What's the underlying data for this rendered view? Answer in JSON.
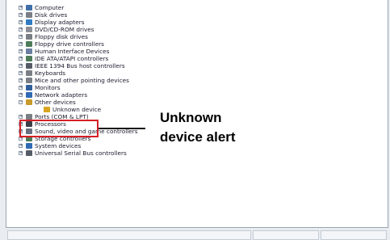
{
  "device_tree": {
    "items": [
      {
        "label": "Computer",
        "color": "#3f6ea8",
        "child": false
      },
      {
        "label": "Disk drives",
        "color": "#7a7f86",
        "child": false
      },
      {
        "label": "Display adapters",
        "color": "#2f7cc4",
        "child": false
      },
      {
        "label": "DVD/CD-ROM drives",
        "color": "#8c8f95",
        "child": false
      },
      {
        "label": "Floppy disk drives",
        "color": "#7a7f86",
        "child": false
      },
      {
        "label": "Floppy drive controllers",
        "color": "#4e7c5a",
        "child": false
      },
      {
        "label": "Human Interface Devices",
        "color": "#6a7fa0",
        "child": false
      },
      {
        "label": "IDE ATA/ATAPI controllers",
        "color": "#4e7c5a",
        "child": false
      },
      {
        "label": "IEEE 1394 Bus host controllers",
        "color": "#555c66",
        "child": false
      },
      {
        "label": "Keyboards",
        "color": "#7a7f86",
        "child": false
      },
      {
        "label": "Mice and other pointing devices",
        "color": "#7a7f86",
        "child": false
      },
      {
        "label": "Monitors",
        "color": "#2f5f9c",
        "child": false
      },
      {
        "label": "Network adapters",
        "color": "#2f6ab4",
        "child": false
      },
      {
        "label": "Other devices",
        "color": "#c89a2a",
        "child": false
      },
      {
        "label": "Unknown device",
        "color": "#d9a520",
        "child": true
      },
      {
        "label": "Ports (COM & LPT)",
        "color": "#7a7f86",
        "child": false
      },
      {
        "label": "Processors",
        "color": "#3a3f47",
        "child": false
      },
      {
        "label": "Sound, video and game controllers",
        "color": "#6a7080",
        "child": false
      },
      {
        "label": "Storage controllers",
        "color": "#4e7c5a",
        "child": false
      },
      {
        "label": "System devices",
        "color": "#2f6ab4",
        "child": false
      },
      {
        "label": "Universal Serial Bus controllers",
        "color": "#555c66",
        "child": false
      }
    ]
  },
  "callout": {
    "line1": "Unknown",
    "line2": "device alert",
    "color": "#d61f26"
  }
}
